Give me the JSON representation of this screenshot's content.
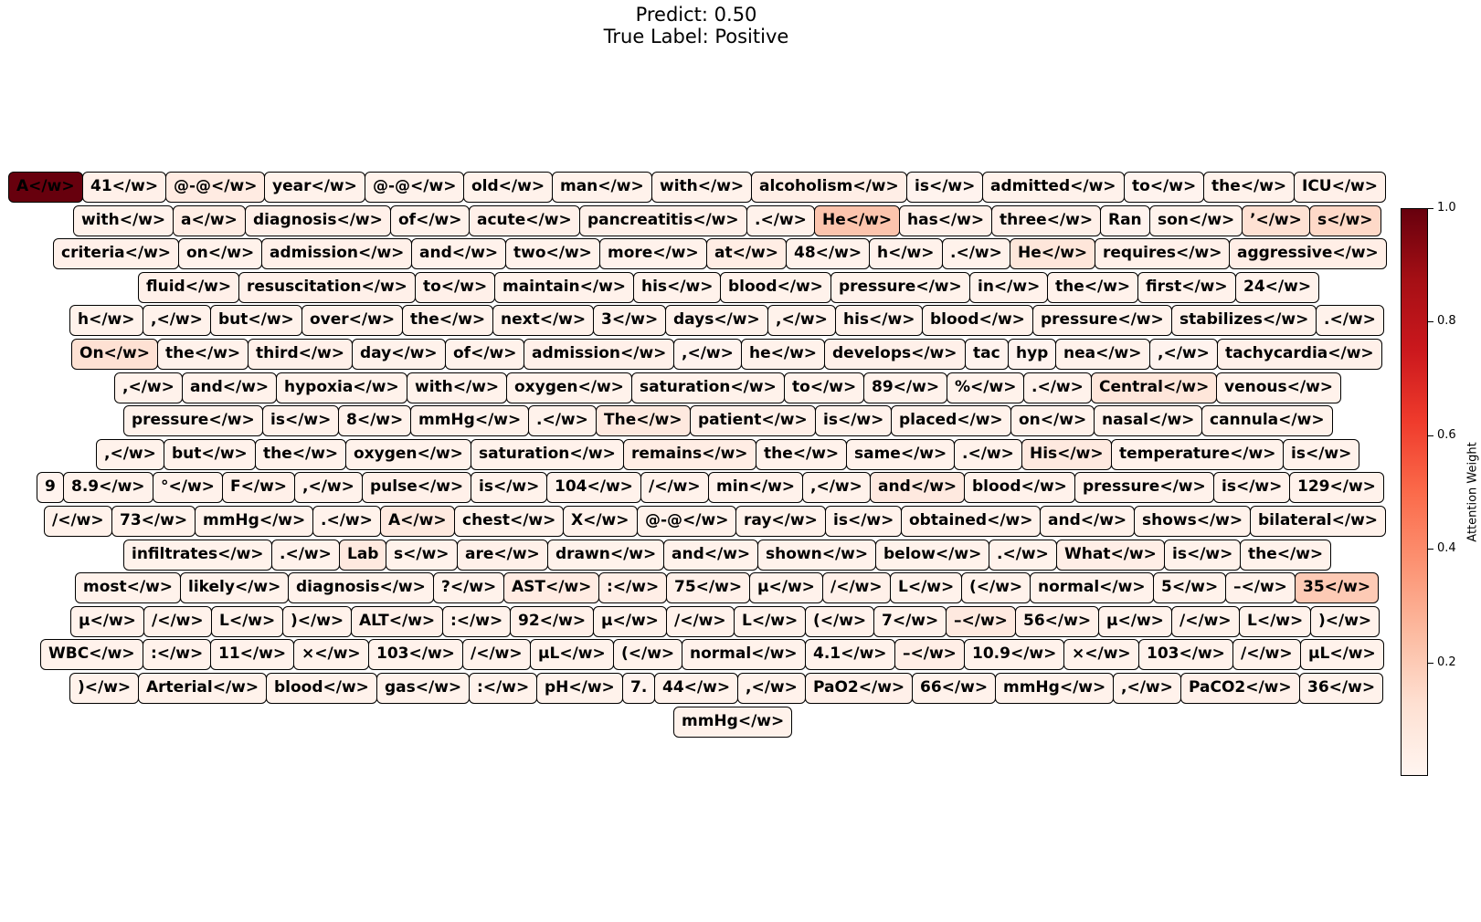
{
  "title": {
    "line1": "Predict: 0.50",
    "line2": "True Label: Positive"
  },
  "colorbar": {
    "label": "Attention Weight",
    "ticks": [
      "0.2",
      "0.4",
      "0.6",
      "0.8",
      "1.0"
    ],
    "tick_values": [
      0.2,
      0.4,
      0.6,
      0.8,
      1.0
    ],
    "range": [
      0.0,
      1.0
    ],
    "colormap": "Reds",
    "colors": [
      "#fff5f0",
      "#fee0d2",
      "#fcbba1",
      "#fc9272",
      "#fb6a4a",
      "#ef3b2c",
      "#cb181d",
      "#a50f15",
      "#67000d"
    ]
  },
  "chart_data": {
    "type": "heatmap",
    "title": "Predict: 0.50\nTrue Label: Positive",
    "colorbar_label": "Attention Weight",
    "vmin": 0.0,
    "vmax": 1.0,
    "rows": [
      [
        [
          "A</w>",
          1.0
        ],
        [
          "41</w>",
          0.03
        ],
        [
          "@-@</w>",
          0.06
        ],
        [
          "year</w>",
          0.02
        ],
        [
          "@-@</w>",
          0.02
        ],
        [
          "old</w>",
          0.02
        ],
        [
          "man</w>",
          0.02
        ],
        [
          "with</w>",
          0.02
        ],
        [
          "alcoholism</w>",
          0.04
        ],
        [
          "is</w>",
          0.01
        ],
        [
          "admitted</w>",
          0.02
        ],
        [
          "to</w>",
          0.01
        ],
        [
          "the</w>",
          0.02
        ],
        [
          "ICU</w>",
          0.03
        ]
      ],
      [
        [
          "with</w>",
          0.02
        ],
        [
          "a</w>",
          0.05
        ],
        [
          "diagnosis</w>",
          0.03
        ],
        [
          "of</w>",
          0.02
        ],
        [
          "acute</w>",
          0.03
        ],
        [
          "pancreatitis</w>",
          0.03
        ],
        [
          ".</w>",
          0.02
        ],
        [
          "He</w>",
          0.22
        ],
        [
          "has</w>",
          0.03
        ],
        [
          "three</w>",
          0.03
        ],
        [
          "Ran",
          0.01
        ],
        [
          "son</w>",
          0.02
        ],
        [
          "’</w>",
          0.12
        ],
        [
          "s</w>",
          0.15
        ]
      ],
      [
        [
          "criteria</w>",
          0.03
        ],
        [
          "on</w>",
          0.02
        ],
        [
          "admission</w>",
          0.03
        ],
        [
          "and</w>",
          0.02
        ],
        [
          "two</w>",
          0.02
        ],
        [
          "more</w>",
          0.02
        ],
        [
          "at</w>",
          0.05
        ],
        [
          "48</w>",
          0.02
        ],
        [
          "h</w>",
          0.02
        ],
        [
          ".</w>",
          0.02
        ],
        [
          "He</w>",
          0.09
        ],
        [
          "requires</w>",
          0.03
        ],
        [
          "aggressive</w>",
          0.04
        ]
      ],
      [
        [
          "fluid</w>",
          0.03
        ],
        [
          "resuscitation</w>",
          0.03
        ],
        [
          "to</w>",
          0.03
        ],
        [
          "maintain</w>",
          0.02
        ],
        [
          "his</w>",
          0.02
        ],
        [
          "blood</w>",
          0.02
        ],
        [
          "pressure</w>",
          0.02
        ],
        [
          "in</w>",
          0.02
        ],
        [
          "the</w>",
          0.02
        ],
        [
          "first</w>",
          0.02
        ],
        [
          "24</w>",
          0.02
        ]
      ],
      [
        [
          "h</w>",
          0.02
        ],
        [
          ",</w>",
          0.02
        ],
        [
          "but</w>",
          0.02
        ],
        [
          "over</w>",
          0.02
        ],
        [
          "the</w>",
          0.02
        ],
        [
          "next</w>",
          0.02
        ],
        [
          "3</w>",
          0.02
        ],
        [
          "days</w>",
          0.02
        ],
        [
          ",</w>",
          0.02
        ],
        [
          "his</w>",
          0.02
        ],
        [
          "blood</w>",
          0.02
        ],
        [
          "pressure</w>",
          0.02
        ],
        [
          "stabilizes</w>",
          0.02
        ],
        [
          ".</w>",
          0.02
        ]
      ],
      [
        [
          "On</w>",
          0.12
        ],
        [
          "the</w>",
          0.02
        ],
        [
          "third</w>",
          0.03
        ],
        [
          "day</w>",
          0.02
        ],
        [
          "of</w>",
          0.02
        ],
        [
          "admission</w>",
          0.03
        ],
        [
          ",</w>",
          0.01
        ],
        [
          "he</w>",
          0.02
        ],
        [
          "develops</w>",
          0.03
        ],
        [
          "tac",
          0.01
        ],
        [
          "hyp",
          0.01
        ],
        [
          "nea</w>",
          0.02
        ],
        [
          ",</w>",
          0.01
        ],
        [
          "tachycardia</w>",
          0.03
        ]
      ],
      [
        [
          ",</w>",
          0.02
        ],
        [
          "and</w>",
          0.02
        ],
        [
          "hypoxia</w>",
          0.02
        ],
        [
          "with</w>",
          0.02
        ],
        [
          "oxygen</w>",
          0.02
        ],
        [
          "saturation</w>",
          0.02
        ],
        [
          "to</w>",
          0.02
        ],
        [
          "89</w>",
          0.02
        ],
        [
          "%</w>",
          0.02
        ],
        [
          ".</w>",
          0.02
        ],
        [
          "Central</w>",
          0.09
        ],
        [
          "venous</w>",
          0.02
        ]
      ],
      [
        [
          "pressure</w>",
          0.02
        ],
        [
          "is</w>",
          0.02
        ],
        [
          "8</w>",
          0.02
        ],
        [
          "mmHg</w>",
          0.02
        ],
        [
          ".</w>",
          0.02
        ],
        [
          "The</w>",
          0.07
        ],
        [
          "patient</w>",
          0.03
        ],
        [
          "is</w>",
          0.02
        ],
        [
          "placed</w>",
          0.02
        ],
        [
          "on</w>",
          0.02
        ],
        [
          "nasal</w>",
          0.02
        ],
        [
          "cannula</w>",
          0.02
        ]
      ],
      [
        [
          ",</w>",
          0.02
        ],
        [
          "but</w>",
          0.02
        ],
        [
          "the</w>",
          0.02
        ],
        [
          "oxygen</w>",
          0.02
        ],
        [
          "saturation</w>",
          0.02
        ],
        [
          "remains</w>",
          0.05
        ],
        [
          "the</w>",
          0.02
        ],
        [
          "same</w>",
          0.02
        ],
        [
          ".</w>",
          0.02
        ],
        [
          "His</w>",
          0.07
        ],
        [
          "temperature</w>",
          0.02
        ],
        [
          "is</w>",
          0.02
        ]
      ],
      [
        [
          "9",
          0.01
        ],
        [
          "8.9</w>",
          0.02
        ],
        [
          "°</w>",
          0.02
        ],
        [
          "F</w>",
          0.03
        ],
        [
          ",</w>",
          0.02
        ],
        [
          "pulse</w>",
          0.03
        ],
        [
          "is</w>",
          0.02
        ],
        [
          "104</w>",
          0.02
        ],
        [
          "/</w>",
          0.02
        ],
        [
          "min</w>",
          0.02
        ],
        [
          ",</w>",
          0.02
        ],
        [
          "and</w>",
          0.07
        ],
        [
          "blood</w>",
          0.02
        ],
        [
          "pressure</w>",
          0.02
        ],
        [
          "is</w>",
          0.02
        ],
        [
          "129</w>",
          0.02
        ]
      ],
      [
        [
          "/</w>",
          0.02
        ],
        [
          "73</w>",
          0.02
        ],
        [
          "mmHg</w>",
          0.02
        ],
        [
          ".</w>",
          0.02
        ],
        [
          "A</w>",
          0.07
        ],
        [
          "chest</w>",
          0.02
        ],
        [
          "X</w>",
          0.02
        ],
        [
          "@-@</w>",
          0.02
        ],
        [
          "ray</w>",
          0.02
        ],
        [
          "is</w>",
          0.02
        ],
        [
          "obtained</w>",
          0.02
        ],
        [
          "and</w>",
          0.02
        ],
        [
          "shows</w>",
          0.02
        ],
        [
          "bilateral</w>",
          0.02
        ]
      ],
      [
        [
          "infiltrates</w>",
          0.02
        ],
        [
          ".</w>",
          0.02
        ],
        [
          "Lab",
          0.07
        ],
        [
          "s</w>",
          0.02
        ],
        [
          "are</w>",
          0.03
        ],
        [
          "drawn</w>",
          0.02
        ],
        [
          "and</w>",
          0.02
        ],
        [
          "shown</w>",
          0.02
        ],
        [
          "below</w>",
          0.02
        ],
        [
          ".</w>",
          0.02
        ],
        [
          "What</w>",
          0.04
        ],
        [
          "is</w>",
          0.02
        ],
        [
          "the</w>",
          0.02
        ]
      ],
      [
        [
          "most</w>",
          0.02
        ],
        [
          "likely</w>",
          0.02
        ],
        [
          "diagnosis</w>",
          0.02
        ],
        [
          "?</w>",
          0.02
        ],
        [
          "AST</w>",
          0.06
        ],
        [
          ":</w>",
          0.04
        ],
        [
          "75</w>",
          0.03
        ],
        [
          "μ</w>",
          0.02
        ],
        [
          "/</w>",
          0.03
        ],
        [
          "L</w>",
          0.02
        ],
        [
          "(</w>",
          0.02
        ],
        [
          "normal</w>",
          0.02
        ],
        [
          "5</w>",
          0.02
        ],
        [
          "–</w>",
          0.02
        ],
        [
          "35</w>",
          0.2
        ]
      ],
      [
        [
          "μ</w>",
          0.02
        ],
        [
          "/</w>",
          0.02
        ],
        [
          "L</w>",
          0.02
        ],
        [
          ")</w>",
          0.02
        ],
        [
          "ALT</w>",
          0.03
        ],
        [
          ":</w>",
          0.02
        ],
        [
          "92</w>",
          0.03
        ],
        [
          "μ</w>",
          0.02
        ],
        [
          "/</w>",
          0.02
        ],
        [
          "L</w>",
          0.02
        ],
        [
          "(</w>",
          0.02
        ],
        [
          "7</w>",
          0.02
        ],
        [
          "–</w>",
          0.07
        ],
        [
          "56</w>",
          0.03
        ],
        [
          "μ</w>",
          0.02
        ],
        [
          "/</w>",
          0.02
        ],
        [
          "L</w>",
          0.02
        ],
        [
          ")</w>",
          0.02
        ]
      ],
      [
        [
          "WBC</w>",
          0.02
        ],
        [
          ":</w>",
          0.02
        ],
        [
          "11</w>",
          0.02
        ],
        [
          "×</w>",
          0.02
        ],
        [
          "103</w>",
          0.02
        ],
        [
          "/</w>",
          0.02
        ],
        [
          "μL</w>",
          0.02
        ],
        [
          "(</w>",
          0.02
        ],
        [
          "normal</w>",
          0.02
        ],
        [
          "4.1</w>",
          0.02
        ],
        [
          "–</w>",
          0.04
        ],
        [
          "10.9</w>",
          0.02
        ],
        [
          "×</w>",
          0.02
        ],
        [
          "103</w>",
          0.02
        ],
        [
          "/</w>",
          0.02
        ],
        [
          "μL</w>",
          0.02
        ]
      ],
      [
        [
          ")</w>",
          0.02
        ],
        [
          "Arterial</w>",
          0.02
        ],
        [
          "blood</w>",
          0.02
        ],
        [
          "gas</w>",
          0.02
        ],
        [
          ":</w>",
          0.02
        ],
        [
          "pH</w>",
          0.02
        ],
        [
          "7.",
          0.01
        ],
        [
          "44</w>",
          0.02
        ],
        [
          ",</w>",
          0.02
        ],
        [
          "PaO2</w>",
          0.03
        ],
        [
          "66</w>",
          0.02
        ],
        [
          "mmHg</w>",
          0.02
        ],
        [
          ",</w>",
          0.02
        ],
        [
          "PaCO2</w>",
          0.03
        ],
        [
          "36</w>",
          0.02
        ]
      ],
      [
        [
          "mmHg</w>",
          0.02
        ]
      ]
    ]
  }
}
